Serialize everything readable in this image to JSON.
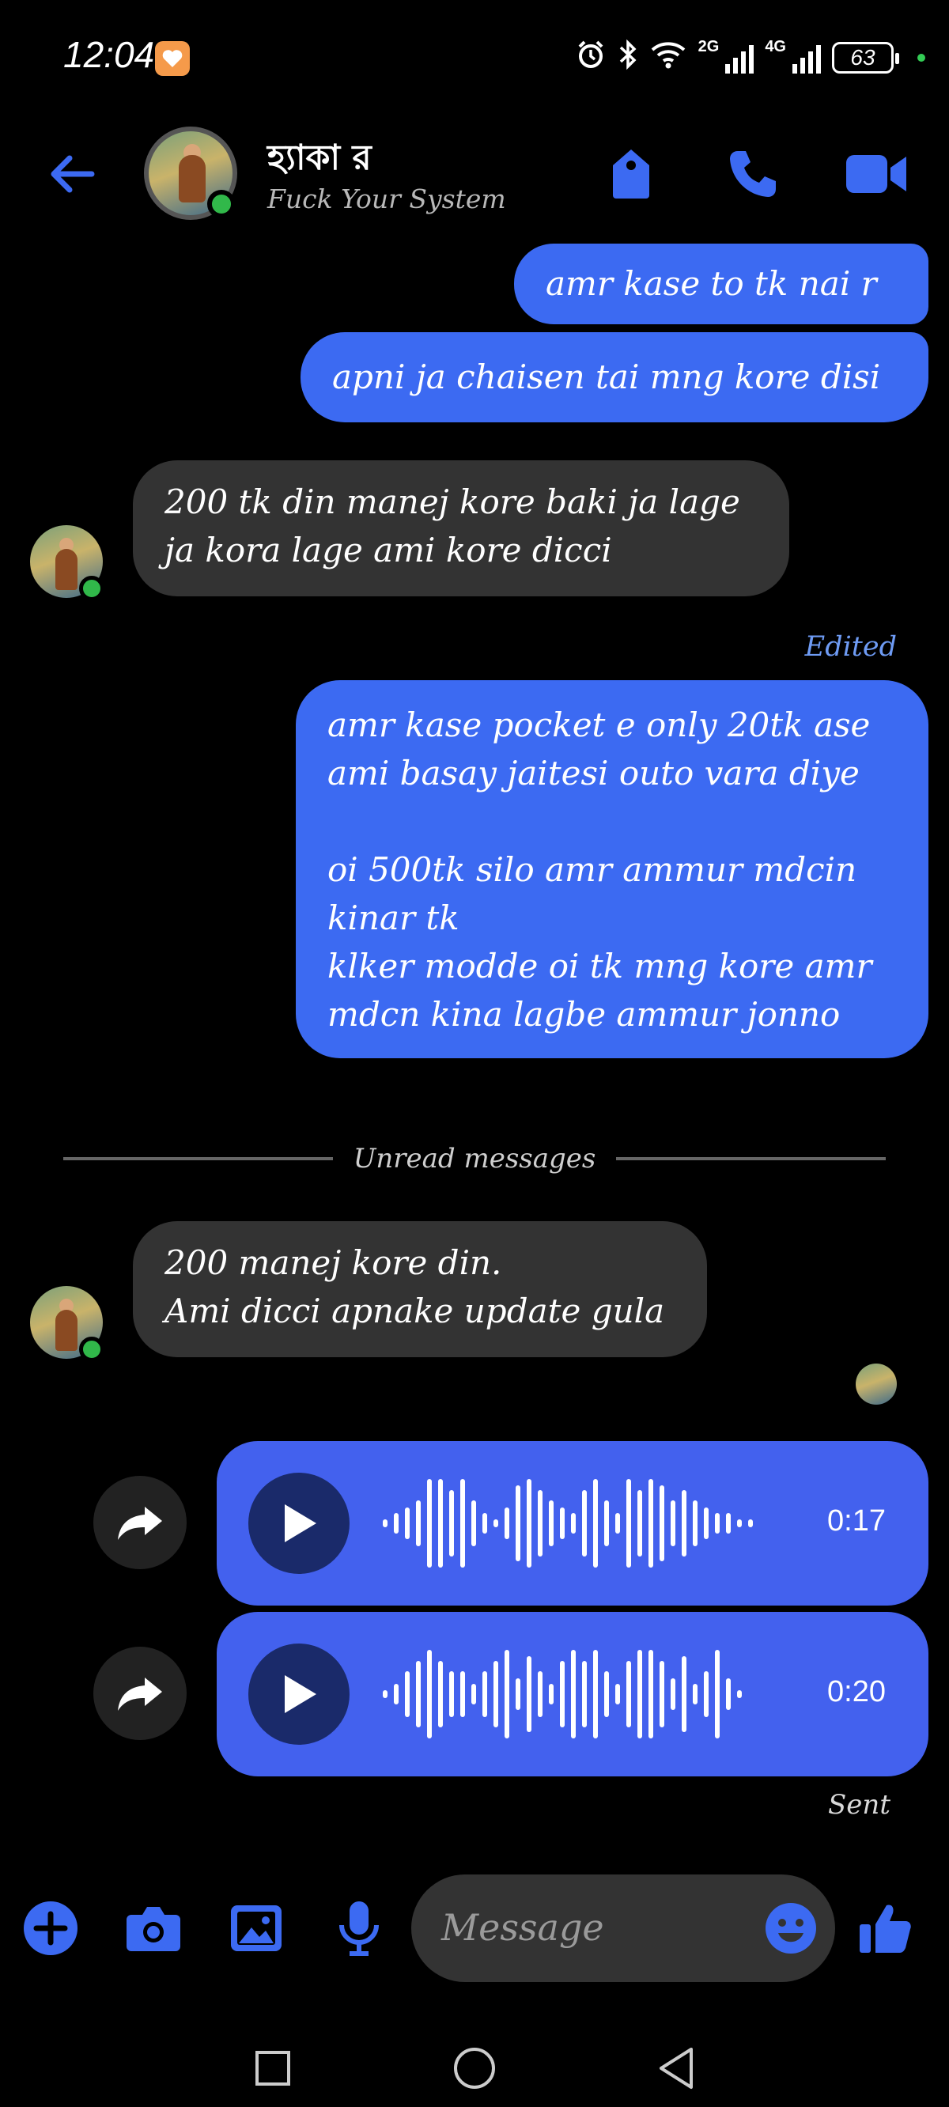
{
  "status_bar": {
    "time": "12:04",
    "network_1": "2G",
    "network_2": "4G",
    "battery": "63"
  },
  "header": {
    "contact_name": "হ্যাকা র",
    "contact_status": "Fuck Your System"
  },
  "messages": [
    {
      "id": "m1",
      "direction": "out",
      "text": "amr kase to tk nai r"
    },
    {
      "id": "m2",
      "direction": "out",
      "text": "apni ja chaisen tai mng kore disi"
    },
    {
      "id": "m3",
      "direction": "in",
      "text": "200 tk din manej kore baki ja lage\nja kora lage ami kore dicci"
    },
    {
      "id": "m4",
      "direction": "out",
      "edited_label": "Edited",
      "text": "amr kase pocket e only 20tk ase\nami basay jaitesi outo vara diye\n\noi 500tk silo amr ammur mdcin\nkinar tk\nklker modde oi tk mng kore amr\nmdcn kina lagbe ammur jonno"
    },
    {
      "id": "m5",
      "direction": "in",
      "text": "200 manej kore din.\nAmi dicci apnake update gula"
    }
  ],
  "divider": {
    "label": "Unread messages"
  },
  "voice_messages": [
    {
      "duration": "0:17"
    },
    {
      "duration": "0:20"
    }
  ],
  "sent_label": "Sent",
  "composer": {
    "placeholder": "Message"
  },
  "colors": {
    "accent": "#3c6af2",
    "voice_bubble": "#4361ee",
    "incoming_bubble": "#333333",
    "online": "#31b84a",
    "edited": "#6e9bf4"
  },
  "icons": {
    "header": [
      "back-arrow-icon",
      "tag-icon",
      "phone-icon",
      "video-camera-icon"
    ],
    "composer": [
      "plus-icon",
      "camera-icon",
      "gallery-icon",
      "microphone-icon",
      "emoji-icon",
      "thumbs-up-icon"
    ],
    "nav": [
      "recents-icon",
      "home-icon",
      "back-icon"
    ]
  }
}
